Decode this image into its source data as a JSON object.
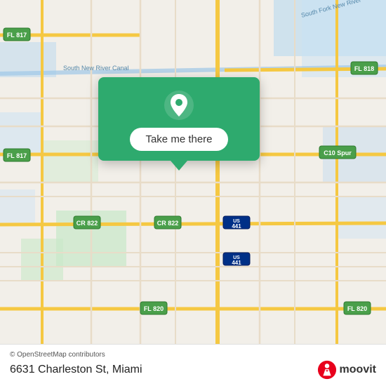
{
  "map": {
    "background_color": "#e8f0e8",
    "attribution": "© OpenStreetMap contributors",
    "attribution_link": "https://www.openstreetmap.org/copyright"
  },
  "popup": {
    "button_label": "Take me there",
    "pin_color": "#ffffff"
  },
  "bottom_bar": {
    "address": "6631 Charleston St, Miami",
    "moovit_label": "moovit"
  }
}
